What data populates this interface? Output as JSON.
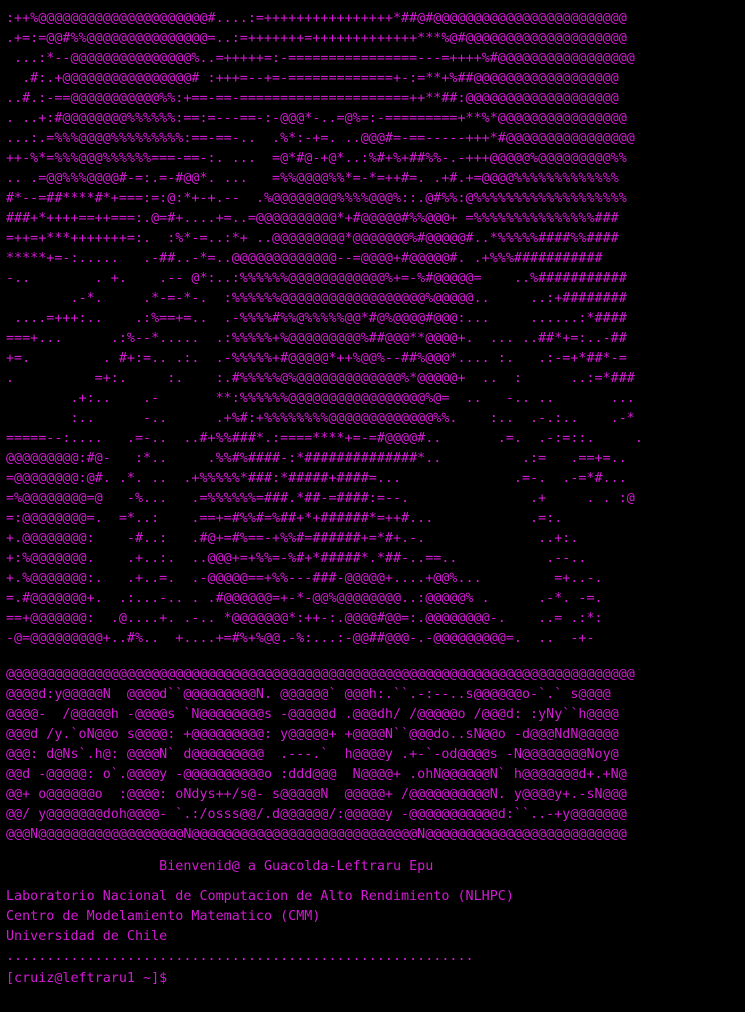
{
  "terminal": {
    "art_lines": [
      " ------------------------------                                 ----------------------------",
      ":++%@@@@@@@@@@@@@@@@@@@@@#....:=++++++++++++++++*##@#@@@@@@@@@@@@@@@@@@@@@@@@",
      ".+=:=@@#%%@@@@@@@@@@@@@@@=..:=+++++++=+++++++++++++***%@#@@@@@@@@@@@@@@@@@@@@",
      " ...:*--@@@@@@@@@@@@@@@%..=+++++=:-================---=++++%#@@@@@@@@@@@@@@@@@",
      "  .#:.+@@@@@@@@@@@@@@@@# :+++=--+=-=============+-:=**+%##@@@@@@@@@@@@@@@@@@",
      "..#.:-==@@@@@@@@@@@%%:+==-==-=====================++**##:@@@@@@@@@@@@@@@@@@@",
      ". ..+:#@@@@@@@@%%%%%%:==:=---==-:-@@@*-..=@%=:-=========+**%*@@@@@@@@@@@@@@@@",
      "...:.=%%%@@@@%%%%%%%%%:==-==-..  .%*:-+=. ..@@@#=-==-----+++*#@@@@@@@@@@@@@@@@",
      "++-%*=%%%@@@%%%%%%===-==-:. ...  =@*#@-+@*..:%#+%+##%%-.-+++@@@@@%@@@@@@@@@%%",
      ".. .=@@%%%@@@@#-=:.=-#@@*. ...   =%%@@@@%%*=-*=++#=. .+#.+=@@@@%%%%%%%%%%%%%",
      "#*--=##****#*+===:=:@:*+-+.--  .%@@@@@@@@%%%%@@@%::.@#%%:@%%%%%%%%%%%%%%%%%%%",
      "###+*++++==++===:.@=#+....+=..=@@@@@@@@@@*+#@@@@@#%%@@@+ =%%%%%%%%%%%%%%%###",
      "=++=+***+++++++=:.  :%*-=..:*+ ..@@@@@@@@@*@@@@@@@%#@@@@@#..*%%%%%####%%####",
      "*****+=-:.....   .-##..-*=..@@@@@@@@@@@@@--=@@@@+#@@@@@#. .+%%%###########",
      "-..        . +.    .-- @*:..:%%%%%%@@@@@@@@@@@@%+=-%#@@@@@=    ..%###########",
      "        .-*.     .*-=-*-.  :%%%%%%@@@@@@@@@@@@@@@@@@%@@@@@..     ..:+########",
      " ....=+++:..    .:%==+=..  .-%%%%#%%@%%%%%@@*#@%@@@@#@@@:...     ......:*####",
      "===+...      .:%--*.....  .:%%%%%+%@@@@@@@@@%##@@@**@@@@+.  ... ..##*+=:..-##",
      "+=.         . #+:=.. .:.  .-%%%%%+#@@@@@*++%@@%--##%@@@*.... :.   .:-=+*##*-=",
      ".          =+:.     :.    :.#%%%%%@%@@@@@@@@@@@@@%*@@@@@+  ..  :      ..:=*###",
      "        .+:..    .-       **:%%%%%%@@@@@@@@@@@@@@@@@%@=  ..   -.. ..       ...",
      "        :..      -..      .+%#:+%%%%%%%%@@@@@@@@@@@@@%%.    :..  .-.:..    .-*",
      "=====--:....   .=-..  ..#+%%###*.:====****+=-=#@@@@#..       .=.  .-:=::.     .",
      "@@@@@@@@@:#@-   :*..     .%%#%####-:*##############*..          .:=   .==+=..",
      "=@@@@@@@@:@#. .*. ..  .+%%%%%*###:*#####+####=...              .=-.  .-=*#...",
      "=%@@@@@@@@=@   -%...   .=%%%%%%=###.*##-=####:=--.               .+     . . :@",
      "=:@@@@@@@@=.  =*..:    .==+=#%%#=%##+*+######*=++#...            .=:.",
      "+.@@@@@@@@:    -#..:   .#@+=#%==-+%%#=######+=*#+.-.              ..+:.",
      "+:%@@@@@@@.    .+..:.  ..@@@+=+%%=-%#+*#####*.*##-..==..           .--..",
      "+.%@@@@@@@:.   .+..=.  .-@@@@@==+%%---###-@@@@@+....+@@%...         =+..-.",
      "=.#@@@@@@@+.  .:...-.. . .#@@@@@@=+-*-@@%@@@@@@@@..:@@@@@% .      .-*. -=.",
      "==+@@@@@@@:  .@....+. .-.. *@@@@@@@*:++-:.@@@@#@@=:.@@@@@@@@-.    ..= .:*:",
      "-@=@@@@@@@@@+..#%..  +....+=#%+%@@.-%:...:-@@##@@@-.-@@@@@@@@@=.  ..  -+-"
    ],
    "logo_lines": [
      "@@@@@@@@@@@@@@@@@@@@@@@@@@@@@@@@@@@@@@@@@@@@@@@@@@@@@@@@@@@@@@@@@@@@@@@@@@@@@@",
      "@@@@d:y@@@@@N  @@@@d``@@@@@@@@@N. @@@@@@` @@@h:.``.-:--..s@@@@@@o-`.` s@@@@",
      "@@@@-  /@@@@@h -@@@@s `N@@@@@@@@s -@@@@@d .@@@dh/ /@@@@@o /@@@d: :yNy``h@@@@",
      "@@@d /y.`oN@@o s@@@@: +@@@@@@@@@: y@@@@@+ +@@@@N``@@@do..sN@@o -d@@@NdN@@@@@",
      "@@@: d@Ns`.h@: @@@@N` d@@@@@@@@@  .---.`  h@@@@y .+-`-od@@@@s -N@@@@@@@@Noy@",
      "@@d -@@@@@: o`.@@@@y -@@@@@@@@@@o :ddd@@@  N@@@@+ .ohN@@@@@@N` h@@@@@@@d+.+N@",
      "@@+ o@@@@@@o  :@@@@: oNdys++/s@- s@@@@@N  @@@@@+ /@@@@@@@@@@N. y@@@@y+.-sN@@@",
      "@@/ y@@@@@@@doh@@@@- `.:/osss@@/.d@@@@@@/:@@@@@y -@@@@@@@@@@@d:``..-+y@@@@@@@",
      "@@@N@@@@@@@@@@@@@@@@@@N@@@@@@@@@@@@@@@@@@@@@@@@@@@@N@@@@@@@@@@@@@@@@@@@@@@@@@"
    ],
    "welcome": "                   Bienvenid@ a Guacolda-Leftraru Epu",
    "info_lines": [
      "Laboratorio Nacional de Computacion de Alto Rendimiento (NLHPC)",
      "Centro de Modelamiento Matematico (CMM)",
      "Universidad de Chile"
    ],
    "separator": "..........................................................",
    "prompt": "[cruiz@leftraru1 ~]$ ",
    "text_color": "#d21ad2",
    "background_color": "#000000"
  }
}
